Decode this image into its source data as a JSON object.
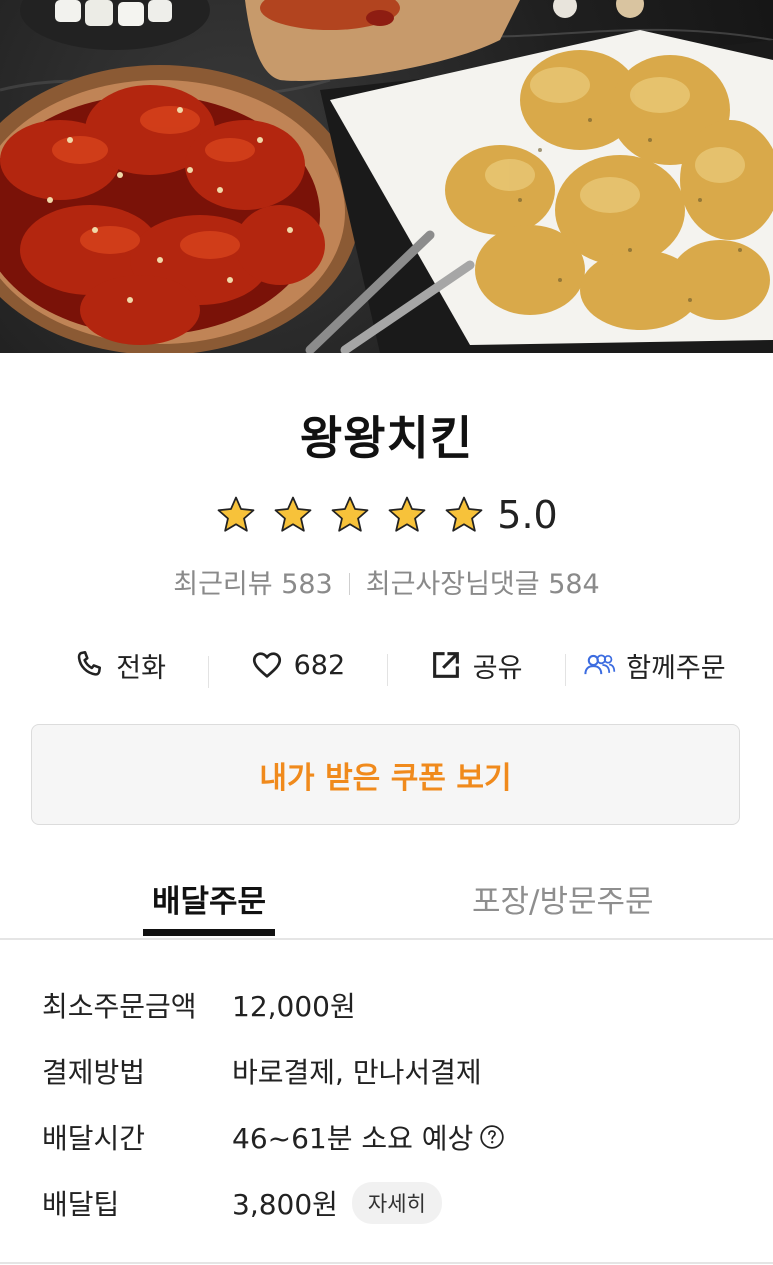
{
  "store": {
    "name": "왕왕치킨",
    "rating": "5.0",
    "stars": 5,
    "recent_reviews": "최근리뷰 583",
    "owner_replies": "최근사장님댓글 584"
  },
  "actions": [
    {
      "label": "전화",
      "icon": "phone-icon"
    },
    {
      "label": "682",
      "icon": "heart-icon"
    },
    {
      "label": "공유",
      "icon": "share-icon"
    },
    {
      "label": "함께주문",
      "icon": "group-order-icon"
    }
  ],
  "coupon": {
    "label": "내가 받은 쿠폰 보기"
  },
  "tabs": [
    {
      "label": "배달주문",
      "active": true
    },
    {
      "label": "포장/방문주문",
      "active": false
    }
  ],
  "info": {
    "min_order": {
      "label": "최소주문금액",
      "value": "12,000원"
    },
    "payment": {
      "label": "결제방법",
      "value": "바로결제, 만나서결제"
    },
    "delivery_time": {
      "label": "배달시간",
      "value": "46~61분 소요 예상"
    },
    "delivery_tip": {
      "label": "배달팁",
      "value": "3,800원",
      "detail_button": "자세히"
    }
  },
  "colors": {
    "accent": "#f08a1c",
    "star": "#f7c23a",
    "group_icon": "#3c6ce0"
  }
}
